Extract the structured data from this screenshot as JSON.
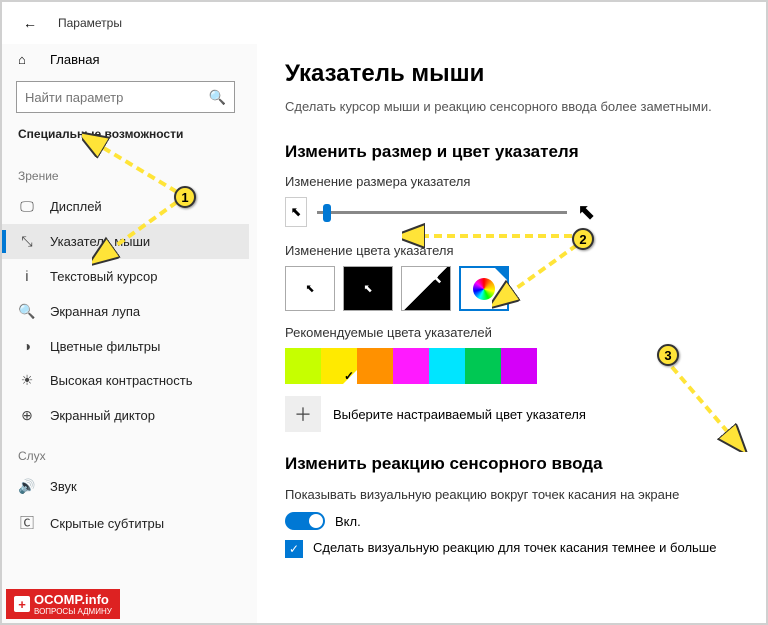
{
  "header": {
    "title": "Параметры"
  },
  "sidebar": {
    "home": "Главная",
    "search_placeholder": "Найти параметр",
    "category": "Специальные возможности",
    "groups": [
      {
        "label": "Зрение",
        "items": [
          {
            "icon": "🖵",
            "label": "Дисплей"
          },
          {
            "icon": "⤡",
            "label": "Указатель мыши",
            "active": true
          },
          {
            "icon": "Ꭵ",
            "label": "Текстовый курсор"
          },
          {
            "icon": "🔍",
            "label": "Экранная лупа"
          },
          {
            "icon": "◑",
            "label": "Цветные фильтры"
          },
          {
            "icon": "☀",
            "label": "Высокая контрастность"
          },
          {
            "icon": "⊕",
            "label": "Экранный диктор"
          }
        ]
      },
      {
        "label": "Слух",
        "items": [
          {
            "icon": "🔊",
            "label": "Звук"
          },
          {
            "icon": "🄲",
            "label": "Скрытые субтитры"
          }
        ]
      }
    ]
  },
  "main": {
    "title": "Указатель мыши",
    "desc": "Сделать курсор мыши и реакцию сенсорного ввода более заметными.",
    "section1": "Изменить размер и цвет указателя",
    "size_label": "Изменение размера указателя",
    "color_label": "Изменение цвета указателя",
    "recommended_label": "Рекомендуемые цвета указателей",
    "swatches": [
      "#c6ff00",
      "#ffea00",
      "#ff9100",
      "#ff1aff",
      "#00e5ff",
      "#00c853",
      "#d500f9"
    ],
    "selected_swatch": 1,
    "custom_label": "Выберите настраиваемый цвет указателя",
    "section2": "Изменить реакцию сенсорного ввода",
    "touch_desc": "Показывать визуальную реакцию вокруг точек касания на экране",
    "toggle_state": "Вкл.",
    "check_label": "Сделать визуальную реакцию для точек касания темнее и больше"
  },
  "annotations": {
    "badges": [
      "1",
      "2",
      "3"
    ]
  },
  "watermark": {
    "brand": "OCOMP",
    "suffix": ".info",
    "sub": "ВОПРОСЫ АДМИНУ"
  }
}
